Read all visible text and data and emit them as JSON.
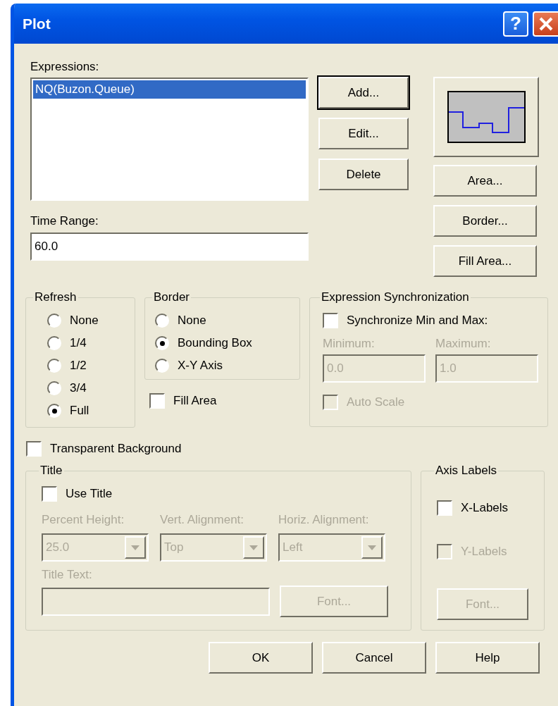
{
  "window": {
    "title": "Plot",
    "help_button": "?"
  },
  "expressions": {
    "label": "Expressions:",
    "items": [
      {
        "text": "NQ(Buzon.Queue)",
        "selected": true
      }
    ]
  },
  "expression_buttons": [
    {
      "label": "Add...",
      "default": true
    },
    {
      "label": "Edit...",
      "default": false
    },
    {
      "label": "Delete",
      "default": false
    }
  ],
  "time_range": {
    "label": "Time Range:",
    "value": "60.0"
  },
  "style_buttons": [
    "Area...",
    "Border...",
    "Fill Area..."
  ],
  "refresh": {
    "title": "Refresh",
    "options": [
      {
        "label": "None",
        "selected": false
      },
      {
        "label": "1/4",
        "selected": false
      },
      {
        "label": "1/2",
        "selected": false
      },
      {
        "label": "3/4",
        "selected": false
      },
      {
        "label": "Full",
        "selected": true
      }
    ]
  },
  "border": {
    "title": "Border",
    "options": [
      {
        "label": "None",
        "selected": false
      },
      {
        "label": "Bounding Box",
        "selected": true
      },
      {
        "label": "X-Y Axis",
        "selected": false
      }
    ]
  },
  "fill_area": {
    "label": "Fill Area",
    "checked": false,
    "disabled": false
  },
  "sync": {
    "title": "Expression Synchronization",
    "synchronize": {
      "label": "Synchronize Min and Max:",
      "checked": false,
      "disabled": false
    },
    "fields": [
      {
        "label": "Minimum:",
        "value": "0.0",
        "disabled": true
      },
      {
        "label": "Maximum:",
        "value": "1.0",
        "disabled": true
      }
    ],
    "auto_scale": {
      "label": "Auto Scale",
      "checked": false,
      "disabled": true
    }
  },
  "transparent_background": {
    "label": "Transparent Background",
    "checked": false,
    "disabled": false
  },
  "title_group": {
    "title": "Title",
    "use_title": {
      "label": "Use Title",
      "checked": false,
      "disabled": false
    },
    "dropdowns": [
      {
        "label": "Percent Height:",
        "value": "25.0",
        "disabled": true
      },
      {
        "label": "Vert. Alignment:",
        "value": "Top",
        "disabled": true
      },
      {
        "label": "Horiz. Alignment:",
        "value": "Left",
        "disabled": true
      }
    ],
    "title_text": {
      "label": "Title Text:",
      "disabled": true
    },
    "font_button": {
      "label": "Font...",
      "disabled": true
    }
  },
  "axis_labels": {
    "title": "Axis Labels",
    "checkboxes": [
      {
        "label": "X-Labels",
        "checked": false,
        "disabled": false
      },
      {
        "label": "Y-Labels",
        "checked": false,
        "disabled": true
      }
    ],
    "font_button": {
      "label": "Font...",
      "disabled": true
    }
  },
  "dialog_buttons": [
    "OK",
    "Cancel",
    "Help"
  ]
}
